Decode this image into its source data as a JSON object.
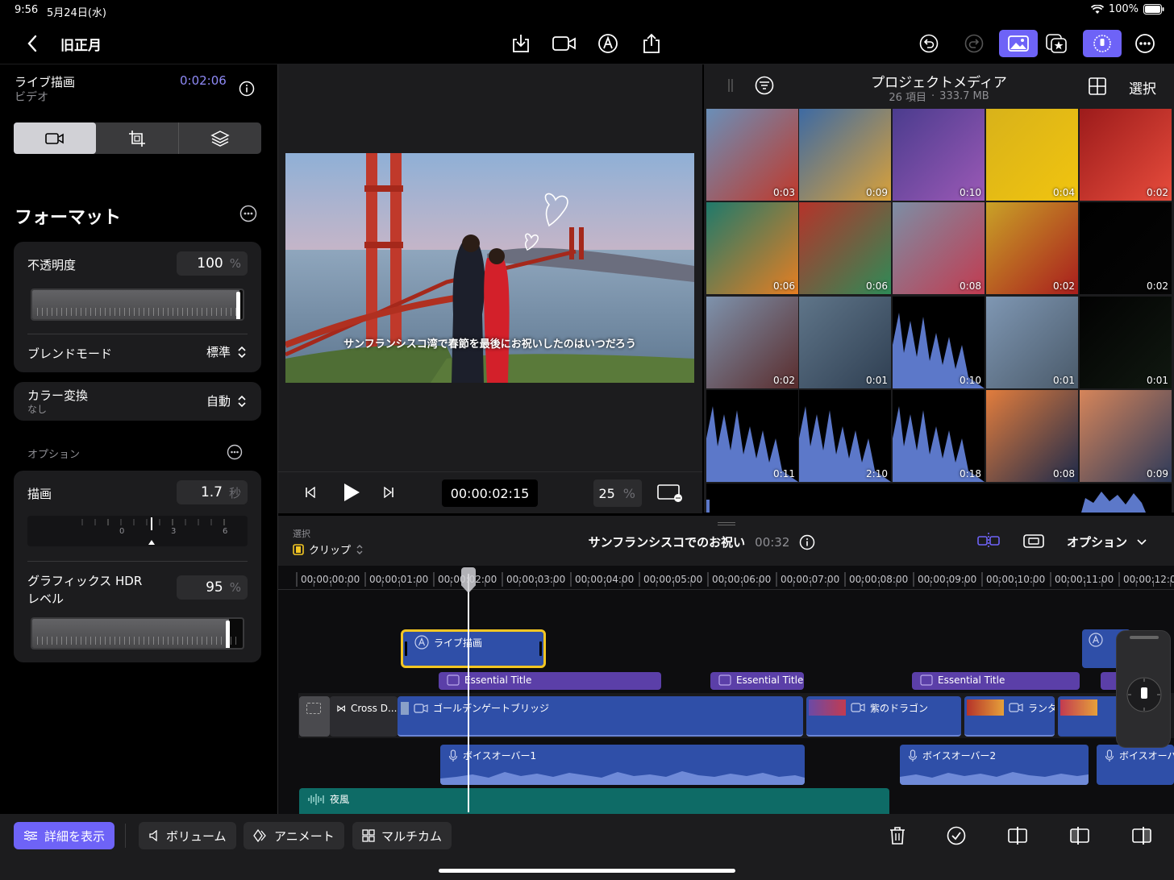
{
  "status": {
    "time": "9:56",
    "date": "5月24日(水)",
    "battery": "100%"
  },
  "topbar": {
    "title": "旧正月",
    "back_icon": "chevron-left-icon"
  },
  "inspector": {
    "clip_name": "ライブ描画",
    "clip_type": "ビデオ",
    "clip_time": "0:02:06",
    "section_title": "フォーマット",
    "opacity": {
      "label": "不透明度",
      "value": "100",
      "unit": "%",
      "level": 1.0
    },
    "blend": {
      "label": "ブレンドモード",
      "value": "標準"
    },
    "color": {
      "label": "カラー変換",
      "sub": "なし",
      "value": "自動"
    },
    "options_label": "オプション",
    "draw": {
      "label": "描画",
      "value": "1.7",
      "unit": "秒",
      "ticks": [
        "0",
        "3",
        "6"
      ]
    },
    "hdr": {
      "label1": "グラフィックス HDR",
      "label2": "レベル",
      "value": "95",
      "unit": "%",
      "level": 0.95
    }
  },
  "viewer": {
    "caption": "サンフランシスコ湾で春節を最後にお祝いしたのはいつだろう",
    "timecode": "00:00:02:15",
    "zoom": "25",
    "zoom_unit": "%"
  },
  "browser": {
    "title": "プロジェクトメディア",
    "count": "26 項目",
    "size": "333.7 MB",
    "dot": "·",
    "select": "選択",
    "thumbs": [
      {
        "dur": "0:03",
        "c1": "#6a8fb8",
        "c2": "#c0392b"
      },
      {
        "dur": "0:09",
        "c1": "#3d6aa3",
        "c2": "#d9a13a"
      },
      {
        "dur": "0:10",
        "c1": "#4b3c8e",
        "c2": "#9b59b6"
      },
      {
        "dur": "0:04",
        "c1": "#d8b21a",
        "c2": "#f1c40f"
      },
      {
        "dur": "0:02",
        "c1": "#9c1b1b",
        "c2": "#e74c3c"
      },
      {
        "dur": "0:06",
        "c1": "#1f7a6b",
        "c2": "#e67e22"
      },
      {
        "dur": "0:06",
        "c1": "#b5332a",
        "c2": "#2e8b57"
      },
      {
        "dur": "0:08",
        "c1": "#7c8ea5",
        "c2": "#c23b50"
      },
      {
        "dur": "0:02",
        "c1": "#c9a227",
        "c2": "#a91d1d"
      },
      {
        "dur": "0:02",
        "c1": "#000000",
        "c2": "#050505"
      },
      {
        "dur": "0:02",
        "c1": "#7e93ad",
        "c2": "#5a2c2c"
      },
      {
        "dur": "0:01",
        "c1": "#5f7589",
        "c2": "#2f3f52"
      },
      {
        "dur": "0:10",
        "c1": "#000000",
        "c2": "#5c78c9"
      },
      {
        "dur": "0:01",
        "c1": "#7f97b3",
        "c2": "#4a5a6a"
      },
      {
        "dur": "0:01",
        "c1": "#020202",
        "c2": "#101810"
      },
      {
        "dur": "0:11",
        "c1": "#000000",
        "c2": "#5c78c9"
      },
      {
        "dur": "2:10",
        "c1": "#000000",
        "c2": "#5c78c9"
      },
      {
        "dur": "0:18",
        "c1": "#000000",
        "c2": "#5c78c9"
      },
      {
        "dur": "0:08",
        "c1": "#e27d3d",
        "c2": "#1e2a4a"
      },
      {
        "dur": "0:09",
        "c1": "#d6855a",
        "c2": "#2d3a5a"
      }
    ]
  },
  "timeline": {
    "select_label": "選択",
    "mode": "クリップ",
    "project_name": "サンフランシスコでのお祝い",
    "duration": "00:32",
    "options": "オプション",
    "ruler": [
      "00:00:00:00",
      "00:00:01:00",
      "00:00:02:00",
      "00:00:03:00",
      "00:00:04:00",
      "00:00:05:00",
      "00:00:06:00",
      "00:00:07:00",
      "00:00:08:00",
      "00:00:09:00",
      "00:00:10:00",
      "00:00:11:00",
      "00:00:12:00"
    ],
    "live_draw": "ライブ描画",
    "titles": [
      "Essential Title",
      "Essential Title",
      "Essential Title"
    ],
    "transition": "Cross D...",
    "clips": [
      "ゴールデンゲートブリッジ",
      "紫のドラゴン",
      "ランタ"
    ],
    "voiceovers": [
      "ボイスオーバー1",
      "ボイスオーバー2",
      "ボイスオーバ"
    ],
    "music": "夜風"
  },
  "bottombar": {
    "details": "詳細を表示",
    "volume": "ボリューム",
    "animate": "アニメート",
    "multicam": "マルチカム"
  },
  "colors": {
    "accent": "#6e63f7",
    "clip_blue": "#2f4fa8",
    "title_purple": "#5b3fa8",
    "music_teal": "#0e6b66",
    "selection_yellow": "#f3c623"
  }
}
